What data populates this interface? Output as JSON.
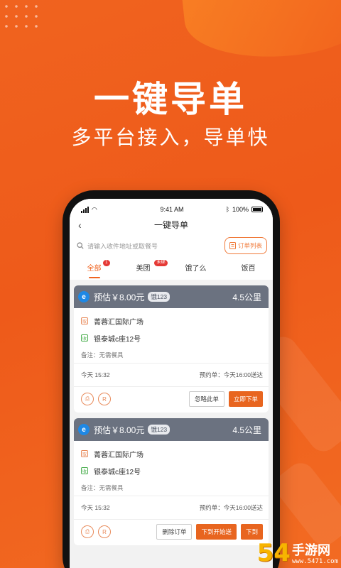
{
  "hero": {
    "title": "一键导单",
    "subtitle": "多平台接入，导单快"
  },
  "status_bar": {
    "time": "9:41 AM",
    "battery": "100%"
  },
  "nav": {
    "title": "一键导单",
    "back_icon": "chevron-left-icon"
  },
  "search": {
    "placeholder": "请输入收件地址或取餐号",
    "order_list_label": "订单列表"
  },
  "tabs": [
    {
      "label": "全部",
      "badge": "1",
      "active": true
    },
    {
      "label": "美团",
      "badge": "未绑",
      "active": false
    },
    {
      "label": "饿了么",
      "badge": "",
      "active": false
    },
    {
      "label": "饭百",
      "badge": "",
      "active": false
    }
  ],
  "orders": [
    {
      "estimate": "预估￥8.00元",
      "code": "饿123",
      "distance": "4.5公里",
      "pickup": "菁蓉汇国际广场",
      "dropoff": "银泰城c座12号",
      "note": "备注：无需餐具",
      "time": "今天 15:32",
      "reservation": "预约单：今天16:00送达",
      "actions": [
        "忽略此单",
        "立即下单"
      ]
    },
    {
      "estimate": "预估￥8.00元",
      "code": "饿123",
      "distance": "4.5公里",
      "pickup": "菁蓉汇国际广场",
      "dropoff": "银泰城c座12号",
      "note": "备注：无需餐具",
      "time": "今天 15:32",
      "reservation": "预约单：今天16:00送达",
      "actions": [
        "删除订单",
        "下到开始送",
        "下到"
      ]
    }
  ],
  "watermark": {
    "number": "54",
    "text": "手游网",
    "url": "www.5471.com"
  },
  "colors": {
    "brand": "#f0631f",
    "card_header": "#6b7280",
    "primary_button": "#e8651f"
  }
}
